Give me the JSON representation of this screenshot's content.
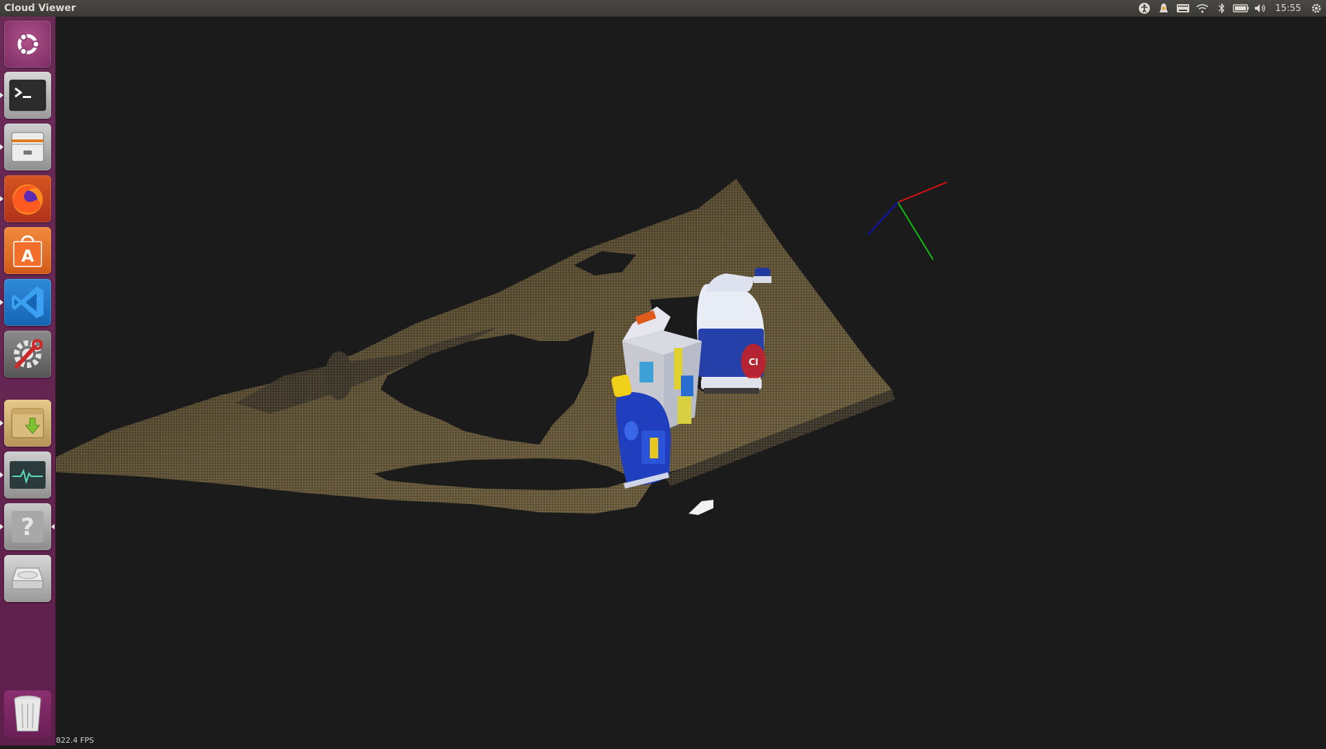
{
  "window": {
    "title": "Cloud Viewer"
  },
  "top_panel": {
    "clock": "15:55",
    "indicators": [
      "accessibility-icon",
      "update-notifier-icon",
      "keyboard-icon",
      "wifi-icon",
      "bluetooth-icon",
      "battery-icon",
      "volume-icon",
      "settings-gear-icon"
    ]
  },
  "launcher": {
    "items": [
      {
        "name": "ubuntu-dash",
        "icon": "ubuntu-logo-icon",
        "running": false
      },
      {
        "name": "terminal",
        "icon": "terminal-icon",
        "running": true
      },
      {
        "name": "files",
        "icon": "file-cabinet-icon",
        "running": true
      },
      {
        "name": "firefox",
        "icon": "firefox-icon",
        "running": true
      },
      {
        "name": "software-center",
        "icon": "shopping-bag-icon",
        "running": false
      },
      {
        "name": "vscode",
        "icon": "vscode-icon",
        "running": true
      },
      {
        "name": "system-settings",
        "icon": "settings-wrench-icon",
        "running": false
      },
      {
        "name": "archive-manager",
        "icon": "download-box-icon",
        "running": true
      },
      {
        "name": "system-monitor",
        "icon": "monitor-pulse-icon",
        "running": true
      },
      {
        "name": "help",
        "icon": "help-icon",
        "running": true
      },
      {
        "name": "drive",
        "icon": "hard-drive-icon",
        "running": false
      },
      {
        "name": "trash",
        "icon": "trash-icon",
        "running": false
      }
    ]
  },
  "viewer": {
    "fps_text": "822.4 FPS",
    "axis_colors": {
      "x": "#e01010",
      "y": "#10c010",
      "z": "#1010c0"
    },
    "objects": [
      "bleach-bottle",
      "milk-carton",
      "detergent-bottle"
    ]
  }
}
